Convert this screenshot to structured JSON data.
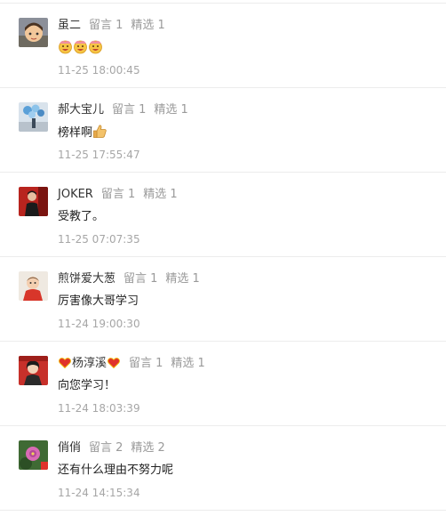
{
  "comments": [
    {
      "name": "虽二",
      "name_decorated": false,
      "messages_label": "留言 1",
      "featured_label": "精选 1",
      "text": "",
      "emojis": [
        "grin-face-icon",
        "grin-face-icon",
        "grin-face-icon"
      ],
      "time": "11-25 18:00:45",
      "avatar_icon": "cartoon-girl-avatar"
    },
    {
      "name": "郝大宝儿",
      "name_decorated": false,
      "messages_label": "留言 1",
      "featured_label": "精选 1",
      "text": "榜样啊",
      "emojis": [
        "thumbs-up-icon"
      ],
      "time": "11-25 17:55:47",
      "avatar_icon": "balloon-photo-avatar"
    },
    {
      "name": "JOKER",
      "name_decorated": false,
      "messages_label": "留言 1",
      "featured_label": "精选 1",
      "text": "受教了。",
      "emojis": [],
      "time": "11-25 07:07:35",
      "avatar_icon": "red-background-person-avatar"
    },
    {
      "name": "煎饼爱大葱",
      "name_decorated": false,
      "messages_label": "留言 1",
      "featured_label": "精选 1",
      "text": "厉害像大哥学习",
      "emojis": [],
      "time": "11-24 19:00:30",
      "avatar_icon": "baby-avatar"
    },
    {
      "name": "杨淳溪",
      "name_decorated": true,
      "messages_label": "留言 1",
      "featured_label": "精选 1",
      "text": "向您学习！",
      "emojis": [],
      "time": "11-24 18:03:39",
      "avatar_icon": "woman-red-wall-avatar"
    },
    {
      "name": "俏俏",
      "name_decorated": false,
      "messages_label": "留言 2",
      "featured_label": "精选 2",
      "text": "还有什么理由不努力呢",
      "emojis": [],
      "time": "11-24 14:15:34",
      "avatar_icon": "flower-avatar"
    }
  ],
  "colors": {
    "meta": "#9a9a9a",
    "divider": "#ececec",
    "heart": "#e0322c"
  }
}
